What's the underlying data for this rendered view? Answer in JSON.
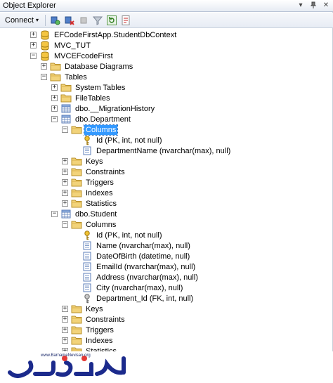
{
  "window": {
    "title": "Object Explorer"
  },
  "toolbar": {
    "connect_label": "Connect",
    "connect_arrow": "▾"
  },
  "tree": {
    "nodes": [
      {
        "label": "EFCodeFirstApp.StudentDbContext",
        "expander": "+"
      },
      {
        "label": "MVC_TUT",
        "expander": "+"
      },
      {
        "label": "MVCEFcodeFirst",
        "expander": "−"
      },
      {
        "label": "Database Diagrams",
        "expander": "+"
      },
      {
        "label": "Tables",
        "expander": "−"
      },
      {
        "label": "System Tables",
        "expander": "+"
      },
      {
        "label": "FileTables",
        "expander": "+"
      },
      {
        "label": "dbo.__MigrationHistory",
        "expander": "+"
      },
      {
        "label": "dbo.Department",
        "expander": "−"
      },
      {
        "label": "Columns",
        "expander": "−"
      },
      {
        "label": "Id (PK, int, not null)",
        "expander": ""
      },
      {
        "label": "DepartmentName (nvarchar(max), null)",
        "expander": ""
      },
      {
        "label": "Keys",
        "expander": "+"
      },
      {
        "label": "Constraints",
        "expander": "+"
      },
      {
        "label": "Triggers",
        "expander": "+"
      },
      {
        "label": "Indexes",
        "expander": "+"
      },
      {
        "label": "Statistics",
        "expander": "+"
      },
      {
        "label": "dbo.Student",
        "expander": "−"
      },
      {
        "label": "Columns",
        "expander": "−"
      },
      {
        "label": "Id (PK, int, not null)",
        "expander": ""
      },
      {
        "label": "Name (nvarchar(max), null)",
        "expander": ""
      },
      {
        "label": "DateOfBirth (datetime, null)",
        "expander": ""
      },
      {
        "label": "EmailId (nvarchar(max), null)",
        "expander": ""
      },
      {
        "label": "Address (nvarchar(max), null)",
        "expander": ""
      },
      {
        "label": "City (nvarchar(max), null)",
        "expander": ""
      },
      {
        "label": "Department_Id (FK, int, null)",
        "expander": ""
      },
      {
        "label": "Keys",
        "expander": "+"
      },
      {
        "label": "Constraints",
        "expander": "+"
      },
      {
        "label": "Triggers",
        "expander": "+"
      },
      {
        "label": "Indexes",
        "expander": "+"
      },
      {
        "label": "Statistics",
        "expander": "+"
      }
    ]
  },
  "watermark": {
    "url": "www.BarnameNevisan.org",
    "logo": "برنامه نویسان"
  },
  "colors": {
    "selection": "#3399ff",
    "folder": "#e8c65a",
    "table": "#5b7db8",
    "key_pk": "#d9a400",
    "key_fk": "#8a8a8a"
  }
}
